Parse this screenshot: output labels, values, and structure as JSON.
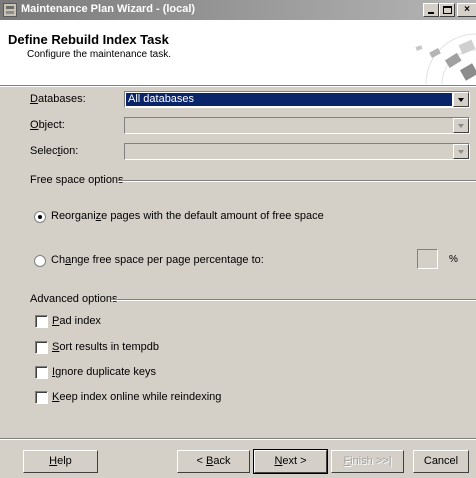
{
  "window": {
    "title": "Maintenance Plan Wizard - (local)",
    "controls": {
      "minimize": "_",
      "maximize": "□",
      "close": "×"
    }
  },
  "header": {
    "title": "Define Rebuild Index Task",
    "subtitle": "Configure the maintenance task."
  },
  "form": {
    "databases": {
      "label": "Databases:",
      "value": "All databases"
    },
    "object": {
      "label": "Object:",
      "value": ""
    },
    "selection": {
      "label": "Selection:",
      "value": ""
    }
  },
  "free_space": {
    "group_label": "Free space options",
    "reorganize": {
      "label": "Reorganize pages with the default amount of free space",
      "checked": true
    },
    "change": {
      "label": "Change free space per page percentage to:",
      "checked": false
    },
    "percent_value": "",
    "percent_sign": "%"
  },
  "advanced": {
    "group_label": "Advanced options",
    "options": [
      {
        "label": "Pad index",
        "checked": false
      },
      {
        "label": "Sort results in tempdb",
        "checked": false
      },
      {
        "label": "Ignore duplicate keys",
        "checked": false
      },
      {
        "label": "Keep index online while reindexing",
        "checked": false
      }
    ]
  },
  "footer": {
    "help": "Help",
    "back": "< Back",
    "next": "Next >",
    "finish": "Finish >>|",
    "cancel": "Cancel"
  },
  "colors": {
    "dialog": "#d4d0c8",
    "selection": "#0a246a",
    "titlebar_start": "#7a7a7a",
    "titlebar_end": "#b5b5b5"
  }
}
